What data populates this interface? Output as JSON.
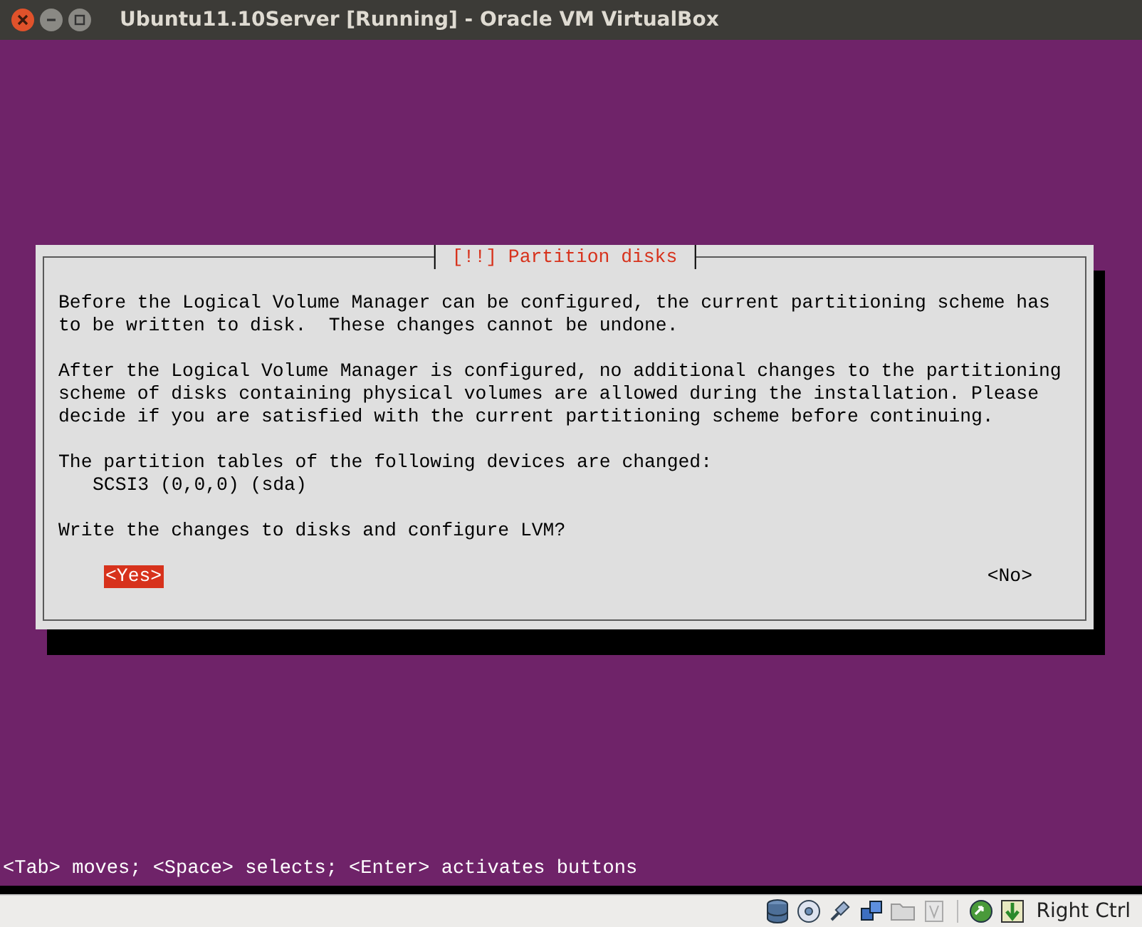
{
  "window": {
    "title": "Ubuntu11.10Server [Running] - Oracle VM VirtualBox"
  },
  "dialog": {
    "title": "[!!] Partition disks",
    "body": [
      {
        "kind": "paragraph",
        "text": "Before the Logical Volume Manager can be configured, the current partitioning scheme has\nto be written to disk.  These changes cannot be undone."
      },
      {
        "kind": "paragraph",
        "text": "After the Logical Volume Manager is configured, no additional changes to the partitioning\nscheme of disks containing physical volumes are allowed during the installation. Please\ndecide if you are satisfied with the current partitioning scheme before continuing."
      },
      {
        "kind": "paragraph",
        "text": "The partition tables of the following devices are changed:"
      },
      {
        "kind": "device",
        "text": "SCSI3 (0,0,0) (sda)"
      },
      {
        "kind": "question",
        "text": "Write the changes to disks and configure LVM?"
      }
    ],
    "buttons": [
      {
        "label": "<Yes>",
        "selected": true
      },
      {
        "label": "<No>",
        "selected": false
      }
    ]
  },
  "help_line": "<Tab> moves; <Space> selects; <Enter> activates buttons",
  "status_bar": {
    "host_key": "Right Ctrl"
  }
}
